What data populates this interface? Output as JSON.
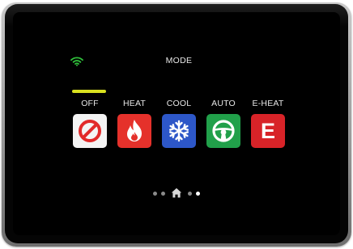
{
  "header": {
    "title": "MODE",
    "wifi_icon": "wifi-icon",
    "wifi_color": "#2fbf3a"
  },
  "modes": [
    {
      "label": "OFF",
      "icon": "off-icon",
      "color": "#f4f4f4",
      "selected": true
    },
    {
      "label": "HEAT",
      "icon": "flame-icon",
      "color": "#e5312b",
      "selected": false
    },
    {
      "label": "COOL",
      "icon": "snowflake-icon",
      "color": "#2d57c8",
      "selected": false
    },
    {
      "label": "AUTO",
      "icon": "steering-wheel-icon",
      "color": "#21a04a",
      "selected": false
    },
    {
      "label": "E-HEAT",
      "icon": "e-icon",
      "color": "#d82328",
      "selected": false,
      "glyph": "E"
    }
  ],
  "selection_indicator_color": "#d9e11f",
  "pager": {
    "icon": "home-icon",
    "page_count": 5,
    "active_page": 4
  }
}
